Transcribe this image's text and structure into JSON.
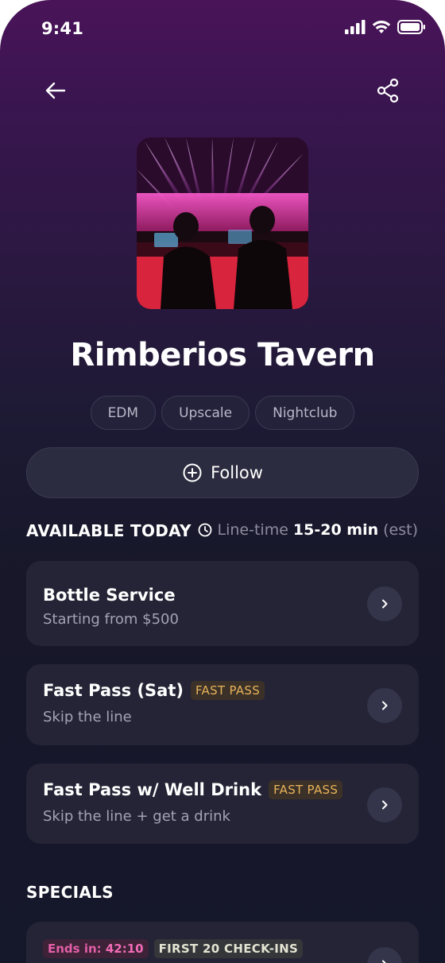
{
  "status_bar": {
    "time": "9:41"
  },
  "header": {
    "back_icon": "arrow-left-icon",
    "share_icon": "share-icon"
  },
  "venue": {
    "name": "Rimberios Tavern",
    "tags": [
      "EDM",
      "Upscale",
      "Nightclub"
    ],
    "image_description_icon": "dj-booth-photo"
  },
  "follow_button": {
    "label": "Follow",
    "icon": "plus-circle-icon"
  },
  "available": {
    "heading": "AVAILABLE TODAY",
    "line_time_label": "Line-time",
    "line_time_value": "15-20 min",
    "line_time_note": "(est)"
  },
  "offers": [
    {
      "title": "Bottle Service",
      "subtitle": "Starting from $500",
      "badge": ""
    },
    {
      "title": "Fast Pass (Sat)",
      "subtitle": "Skip the line",
      "badge": "FAST PASS"
    },
    {
      "title": "Fast Pass w/ Well Drink",
      "subtitle": "Skip the line + get a drink",
      "badge": "FAST PASS"
    }
  ],
  "specials": {
    "heading": "SPECIALS",
    "items": [
      {
        "ends_label": "Ends in:",
        "ends_value": "42:10",
        "badge": "FIRST 20 CHECK-INS"
      }
    ]
  },
  "colors": {
    "accent_gold": "#e7b35a",
    "accent_pink": "#f06cb6",
    "bg_top": "#4a1459",
    "bg_bottom": "#15172a"
  }
}
